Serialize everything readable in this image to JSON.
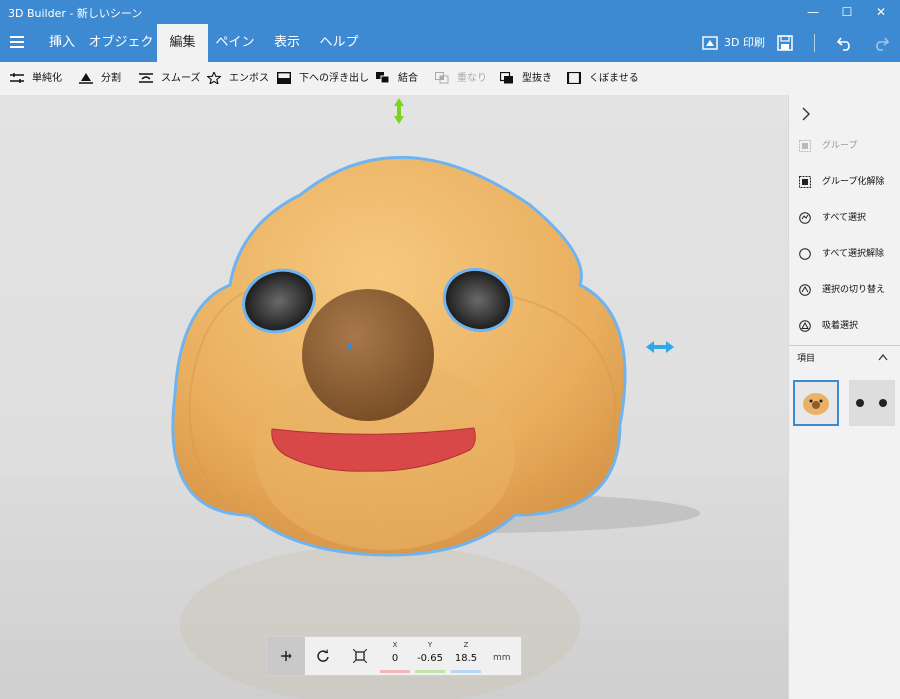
{
  "window": {
    "title": "3D Builder - 新しいシーン",
    "minimize": "—",
    "maximize": "☐",
    "close": "✕"
  },
  "menu": {
    "tabs": [
      "挿入",
      "オブジェクト",
      "編集",
      "ペイント",
      "表示",
      "ヘルプ"
    ],
    "active_tab": "編集",
    "print_label": "3D 印刷"
  },
  "toolbar": {
    "items": [
      {
        "label": "単純化",
        "icon": "simplify-icon",
        "enabled": true
      },
      {
        "label": "分割",
        "icon": "split-icon",
        "enabled": true
      },
      {
        "label": "スムーズ",
        "icon": "smooth-icon",
        "enabled": true
      },
      {
        "label": "エンボス",
        "icon": "star-icon",
        "enabled": true
      },
      {
        "label": "下への浮き出し",
        "icon": "extrude-down-icon",
        "enabled": true
      },
      {
        "label": "結合",
        "icon": "merge-icon",
        "enabled": true
      },
      {
        "label": "重なり",
        "icon": "intersect-icon",
        "enabled": false
      },
      {
        "label": "型抜き",
        "icon": "subtract-icon",
        "enabled": true
      },
      {
        "label": "くぼませる",
        "icon": "hollow-icon",
        "enabled": true
      }
    ]
  },
  "sidepanel": {
    "items": [
      {
        "label": "グループ",
        "icon": "group-icon",
        "enabled": false
      },
      {
        "label": "グループ化解除",
        "icon": "ungroup-icon",
        "enabled": true
      },
      {
        "label": "すべて選択",
        "icon": "select-all-icon",
        "enabled": true
      },
      {
        "label": "すべて選択解除",
        "icon": "deselect-all-icon",
        "enabled": true
      },
      {
        "label": "選択の切り替え",
        "icon": "toggle-selection-icon",
        "enabled": true
      },
      {
        "label": "吸着選択",
        "icon": "triangle-icon",
        "enabled": true
      }
    ],
    "section_title": "項目"
  },
  "coords": {
    "x_label": "X",
    "x_value": "0",
    "y_label": "Y",
    "y_value": "-0.65",
    "z_label": "Z",
    "z_value": "18.5",
    "unit": "mm"
  },
  "colors": {
    "accent": "#3e8ad2",
    "face": "#eab266",
    "nose": "#8d5c2e",
    "mouth": "#d94848",
    "selection": "#6fb4f0"
  }
}
